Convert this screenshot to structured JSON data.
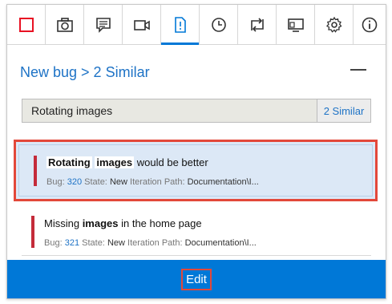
{
  "toolbar": {
    "buttons": [
      {
        "icon": "stop-record-icon",
        "color": "#e81123"
      },
      {
        "icon": "camera-icon"
      },
      {
        "icon": "note-icon"
      },
      {
        "icon": "video-icon"
      },
      {
        "icon": "bug-icon",
        "active": true
      },
      {
        "icon": "clock-icon"
      },
      {
        "icon": "switch-icon"
      },
      {
        "icon": "device-icon"
      },
      {
        "icon": "gear-icon"
      },
      {
        "icon": "info-icon"
      }
    ]
  },
  "header": {
    "title": "New bug > 2 Similar"
  },
  "search": {
    "value": "Rotating images",
    "similar_count": "2 Similar"
  },
  "results": [
    {
      "title_parts": [
        "Rotating",
        " ",
        "images",
        " would be better"
      ],
      "bug_label": "Bug:",
      "bug_id": "320",
      "state_label": "State:",
      "state": "New",
      "path_label": "Iteration Path:",
      "path": "Documentation\\I..."
    },
    {
      "title_parts": [
        "Missing ",
        "images",
        " in the home page"
      ],
      "bug_label": "Bug:",
      "bug_id": "321",
      "state_label": "State:",
      "state": "New",
      "path_label": "Iteration Path:",
      "path": "Documentation\\I..."
    }
  ],
  "footer": {
    "edit_label": "Edit"
  },
  "colors": {
    "accent": "#0078d7",
    "link": "#1e73c6",
    "bug_bar": "#c42b3a",
    "highlight_box": "#e3483a"
  }
}
